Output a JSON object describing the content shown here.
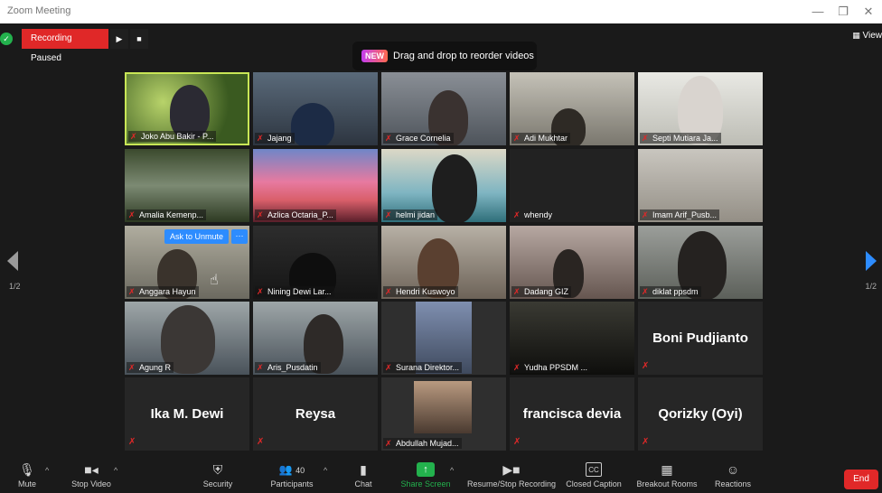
{
  "window": {
    "title": "Zoom Meeting",
    "minimize": "—",
    "restore": "❐",
    "close": "✕"
  },
  "recording": {
    "label": "Recording Paused",
    "resume_icon": "▶",
    "stop_icon": "■"
  },
  "toast": {
    "badge": "NEW",
    "text": "Drag and drop to reorder videos"
  },
  "view_button": "View",
  "pager": {
    "left": "1/2",
    "right": "1/2"
  },
  "tiles": {
    "joko": "Joko Abu Bakir - P...",
    "jajang": "Jajang",
    "grace": "Grace Cornelia",
    "adi": "Adi Mukhtar",
    "septi": "Septi Mutiara Ja...",
    "amalia": "Amalia Kemenp...",
    "azlica": "Azlica Octaria_P...",
    "helmi": "helmi jidan",
    "whendy": "whendy",
    "imam": "Imam Arif_Pusb...",
    "anggara": "Anggara Hayun",
    "nining": "Nining Dewi Lar...",
    "hendri": "Hendri Kuswoyo",
    "dadang": "Dadang GIZ",
    "diklat": "diklat ppsdm",
    "agung": "Agung R",
    "aris": "Aris_Pusdatin",
    "surana": "Surana Direktor...",
    "yudha": "Yudha PPSDM ...",
    "boni": "Boni Pudjianto",
    "ika": "Ika M. Dewi",
    "reysa": "Reysa",
    "abdullah": "Abdullah Mujad...",
    "francisca": "francisca devia",
    "qorizky": "Qorizky (Oyi)"
  },
  "ask_to_unmute": "Ask to Unmute",
  "more_dots": "···",
  "toolbar": {
    "mute": "Mute",
    "stop_video": "Stop Video",
    "security": "Security",
    "participants": "Participants",
    "participants_count": "40",
    "chat": "Chat",
    "share_screen": "Share Screen",
    "record": "Resume/Stop Recording",
    "closed_caption": "Closed Caption",
    "cc_icon_text": "CC",
    "breakout_rooms": "Breakout Rooms",
    "reactions": "Reactions",
    "end": "End"
  }
}
